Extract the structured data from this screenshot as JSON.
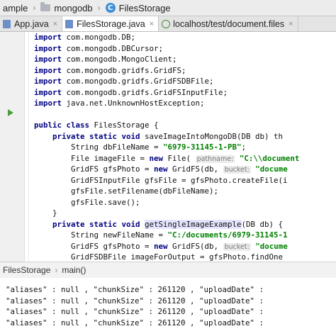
{
  "breadcrumb": {
    "items": [
      {
        "label": "ample",
        "icon": "folder-icon"
      },
      {
        "label": "mongodb",
        "icon": "folder-icon"
      },
      {
        "label": "FilesStorage",
        "icon": "class-icon",
        "icon_glyph": "C"
      }
    ]
  },
  "tabs": [
    {
      "label": "App.java",
      "close": "×"
    },
    {
      "label": "FilesStorage.java",
      "close": "×",
      "active": true
    },
    {
      "label": "localhost/test/document.files",
      "close": "×"
    }
  ],
  "code_lines": [
    {
      "indent": "",
      "parts": [
        [
          "kw",
          "import"
        ],
        [
          "",
          "com.mongodb.DB;"
        ]
      ]
    },
    {
      "indent": "",
      "parts": [
        [
          "kw",
          "import"
        ],
        [
          "",
          "com.mongodb.DBCursor;"
        ]
      ]
    },
    {
      "indent": "",
      "parts": [
        [
          "kw",
          "import"
        ],
        [
          "",
          "com.mongodb.MongoClient;"
        ]
      ]
    },
    {
      "indent": "",
      "parts": [
        [
          "kw",
          "import"
        ],
        [
          "",
          "com.mongodb.gridfs.GridFS;"
        ]
      ]
    },
    {
      "indent": "",
      "parts": [
        [
          "kw",
          "import"
        ],
        [
          "",
          "com.mongodb.gridfs.GridFSDBFile;"
        ]
      ]
    },
    {
      "indent": "",
      "parts": [
        [
          "kw",
          "import"
        ],
        [
          "",
          "com.mongodb.gridfs.GridFSInputFile;"
        ]
      ]
    },
    {
      "indent": "",
      "parts": [
        [
          "kw",
          "import"
        ],
        [
          "",
          "java.net.UnknownHostException;"
        ]
      ]
    },
    {
      "indent": "",
      "parts": []
    },
    {
      "indent": "",
      "parts": [
        [
          "kw",
          "public class"
        ],
        [
          "",
          "FilesStorage {"
        ]
      ]
    },
    {
      "indent": "    ",
      "parts": [
        [
          "kw",
          "private static void"
        ],
        [
          "",
          "saveImageIntoMongoDB(DB db) th"
        ]
      ]
    },
    {
      "indent": "        ",
      "parts": [
        [
          "",
          "String dbFileName = "
        ],
        [
          "str",
          "\"6979-31145-1-PB\""
        ],
        [
          "",
          ";"
        ]
      ]
    },
    {
      "indent": "        ",
      "parts": [
        [
          "",
          "File imageFile = "
        ],
        [
          "kw",
          "new"
        ],
        [
          "",
          "File( "
        ],
        [
          "hint",
          "pathname:"
        ],
        [
          "",
          " "
        ],
        [
          "str",
          "\"C:\\\\document"
        ]
      ]
    },
    {
      "indent": "        ",
      "parts": [
        [
          "",
          "GridFS gfsPhoto = "
        ],
        [
          "kw",
          "new"
        ],
        [
          "",
          "GridFS(db, "
        ],
        [
          "hint",
          "bucket:"
        ],
        [
          "",
          " "
        ],
        [
          "str",
          "\"docume"
        ]
      ]
    },
    {
      "indent": "        ",
      "parts": [
        [
          "",
          "GridFSInputFile gfsFile = gfsPhoto.createFile(i"
        ]
      ]
    },
    {
      "indent": "        ",
      "parts": [
        [
          "",
          "gfsFile.setFilename(dbFileName);"
        ]
      ]
    },
    {
      "indent": "        ",
      "parts": [
        [
          "",
          "gfsFile.save();"
        ]
      ]
    },
    {
      "indent": "    ",
      "parts": [
        [
          "",
          "}"
        ]
      ]
    },
    {
      "indent": "    ",
      "parts": [
        [
          "kw",
          "private static void"
        ],
        [
          "mhl",
          "getSingleImageExample"
        ],
        [
          "",
          "(DB db) {"
        ]
      ]
    },
    {
      "indent": "        ",
      "parts": [
        [
          "",
          "String newFileName = "
        ],
        [
          "str",
          "\"C:/documents/6979-31145-1"
        ]
      ]
    },
    {
      "indent": "        ",
      "parts": [
        [
          "",
          "GridFS gfsPhoto = "
        ],
        [
          "kw",
          "new"
        ],
        [
          "",
          "GridFS(db, "
        ],
        [
          "hint",
          "bucket:"
        ],
        [
          "",
          " "
        ],
        [
          "str",
          "\"docume"
        ]
      ]
    },
    {
      "indent": "        ",
      "parts": [
        [
          "",
          "GridFSDBFile imageForOutput = gfsPhoto.findOne"
        ]
      ]
    },
    {
      "indent": "        ",
      "parts": [
        [
          "",
          "System."
        ],
        [
          "fld",
          "out"
        ],
        [
          "",
          ".println(imageForOutput);"
        ]
      ]
    },
    {
      "indent": "    ",
      "parts": [
        [
          "",
          "}"
        ]
      ]
    },
    {
      "indent": "    ",
      "parts": [
        [
          "kw",
          "private static void"
        ],
        [
          "",
          "listAllImages(DB db) {"
        ]
      ]
    }
  ],
  "status_path": [
    "FilesStorage",
    "main()"
  ],
  "status_sep": "›",
  "console_lines": [
    "\"aliases\" : null , \"chunkSize\" : 261120 , \"uploadDate\" :",
    "\"aliases\" : null , \"chunkSize\" : 261120 , \"uploadDate\" :",
    "\"aliases\" : null , \"chunkSize\" : 261120 , \"uploadDate\" :",
    "\"aliases\" : null , \"chunkSize\" : 261120 , \"uploadDate\" :"
  ],
  "colors": {
    "keyword": "#000080",
    "string": "#008000",
    "static_field": "#660e7a",
    "run_icon": "#4a9e3a",
    "caret_line": "#fcfad6"
  }
}
